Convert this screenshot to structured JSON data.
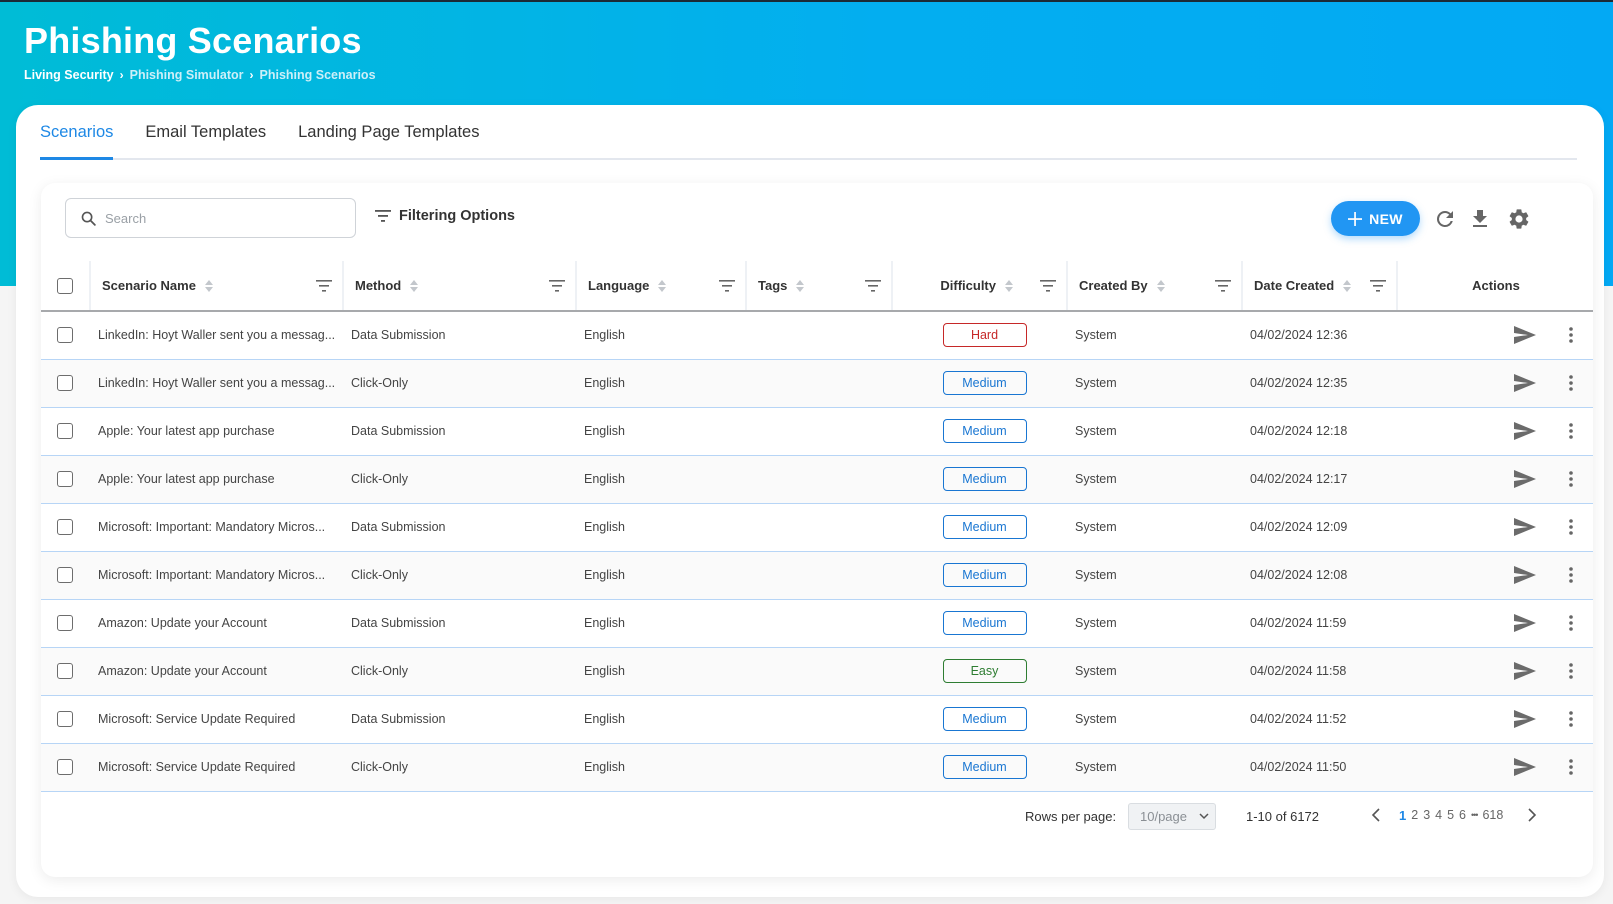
{
  "header": {
    "title": "Phishing Scenarios",
    "breadcrumb": [
      "Living Security",
      "Phishing Simulator",
      "Phishing Scenarios"
    ]
  },
  "tabs": [
    {
      "label": "Scenarios",
      "active": true
    },
    {
      "label": "Email Templates",
      "active": false
    },
    {
      "label": "Landing Page Templates",
      "active": false
    }
  ],
  "toolbar": {
    "search_placeholder": "Search",
    "search_value": "",
    "filter_label": "Filtering Options",
    "new_label": "NEW",
    "icons": [
      "refresh-icon",
      "download-icon",
      "gear-icon"
    ]
  },
  "table": {
    "columns": [
      "Scenario Name",
      "Method",
      "Language",
      "Tags",
      "Difficulty",
      "Created By",
      "Date Created",
      "Actions"
    ],
    "rows": [
      {
        "name": "LinkedIn: Hoyt Waller sent you a messag...",
        "method": "Data Submission",
        "language": "English",
        "tags": "",
        "difficulty": "Hard",
        "created_by": "System",
        "date": "04/02/2024 12:36"
      },
      {
        "name": "LinkedIn: Hoyt Waller sent you a messag...",
        "method": "Click-Only",
        "language": "English",
        "tags": "",
        "difficulty": "Medium",
        "created_by": "System",
        "date": "04/02/2024 12:35"
      },
      {
        "name": "Apple: Your latest app purchase",
        "method": "Data Submission",
        "language": "English",
        "tags": "",
        "difficulty": "Medium",
        "created_by": "System",
        "date": "04/02/2024 12:18"
      },
      {
        "name": "Apple: Your latest app purchase",
        "method": "Click-Only",
        "language": "English",
        "tags": "",
        "difficulty": "Medium",
        "created_by": "System",
        "date": "04/02/2024 12:17"
      },
      {
        "name": "Microsoft: Important: Mandatory Micros...",
        "method": "Data Submission",
        "language": "English",
        "tags": "",
        "difficulty": "Medium",
        "created_by": "System",
        "date": "04/02/2024 12:09"
      },
      {
        "name": "Microsoft: Important: Mandatory Micros...",
        "method": "Click-Only",
        "language": "English",
        "tags": "",
        "difficulty": "Medium",
        "created_by": "System",
        "date": "04/02/2024 12:08"
      },
      {
        "name": "Amazon: Update your Account",
        "method": "Data Submission",
        "language": "English",
        "tags": "",
        "difficulty": "Medium",
        "created_by": "System",
        "date": "04/02/2024 11:59"
      },
      {
        "name": "Amazon: Update your Account",
        "method": "Click-Only",
        "language": "English",
        "tags": "",
        "difficulty": "Easy",
        "created_by": "System",
        "date": "04/02/2024 11:58"
      },
      {
        "name": "Microsoft: Service Update Required",
        "method": "Data Submission",
        "language": "English",
        "tags": "",
        "difficulty": "Medium",
        "created_by": "System",
        "date": "04/02/2024 11:52"
      },
      {
        "name": "Microsoft: Service Update Required",
        "method": "Click-Only",
        "language": "English",
        "tags": "",
        "difficulty": "Medium",
        "created_by": "System",
        "date": "04/02/2024 11:50"
      }
    ]
  },
  "difficulty_colors": {
    "Hard": "#c62828",
    "Medium": "#1976d2",
    "Easy": "#2e7d32"
  },
  "pagination": {
    "rows_per_page_label": "Rows per page:",
    "rows_per_page_value": "10/page",
    "range_text": "1-10 of 6172",
    "pages": [
      "1",
      "2",
      "3",
      "4",
      "5",
      "6"
    ],
    "ellipsis": "•••",
    "last_page": "618",
    "current_page": "1"
  },
  "colors": {
    "accent": "#2196f3",
    "header_gradient_start": "#00bcd6",
    "header_gradient_end": "#03a9f4"
  }
}
